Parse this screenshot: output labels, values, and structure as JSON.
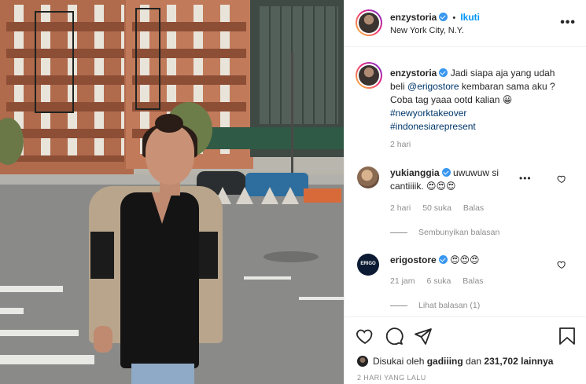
{
  "header": {
    "username": "enzystoria",
    "separator": "•",
    "follow_label": "Ikuti",
    "location": "New York City, N.Y.",
    "more_label": "•••"
  },
  "caption": {
    "username": "enzystoria",
    "text_1": "Jadi siapa aja yang udah beli ",
    "mention": "@erigostore",
    "text_2": " kembaran sama aku ? Coba tag yaaa ootd kalian 😀",
    "hashtag_1": "#newyorktakeover",
    "hashtag_2": "#indonesiarepresent",
    "time": "2 hari"
  },
  "comments": [
    {
      "username": "yukianggia",
      "text": "uwuwuw si cantiiiik. 😍😍😍",
      "time": "2 hari",
      "likes": "50 suka",
      "reply": "Balas",
      "more": "•••",
      "thread_label": "Sembunyikan balasan"
    },
    {
      "username": "erigostore",
      "avatar_text": "ERIGO",
      "text": "😍😍😍",
      "time": "21 jam",
      "likes": "6 suka",
      "reply": "Balas",
      "thread_label": "Lihat balasan (1)"
    }
  ],
  "footer": {
    "liked_by_prefix": "Disukai oleh ",
    "liked_by_user": "gadiiing",
    "liked_by_mid": " dan ",
    "liked_by_count": "231,702 lainnya",
    "time_ago": "2 HARI YANG LALU"
  },
  "colors": {
    "link": "#0095f6",
    "hashtag": "#00376b",
    "verified": "#3897f0",
    "muted": "#8e8e8e"
  },
  "icons": [
    "heart-icon",
    "comment-icon",
    "share-icon",
    "bookmark-icon",
    "verified-icon",
    "more-icon"
  ]
}
